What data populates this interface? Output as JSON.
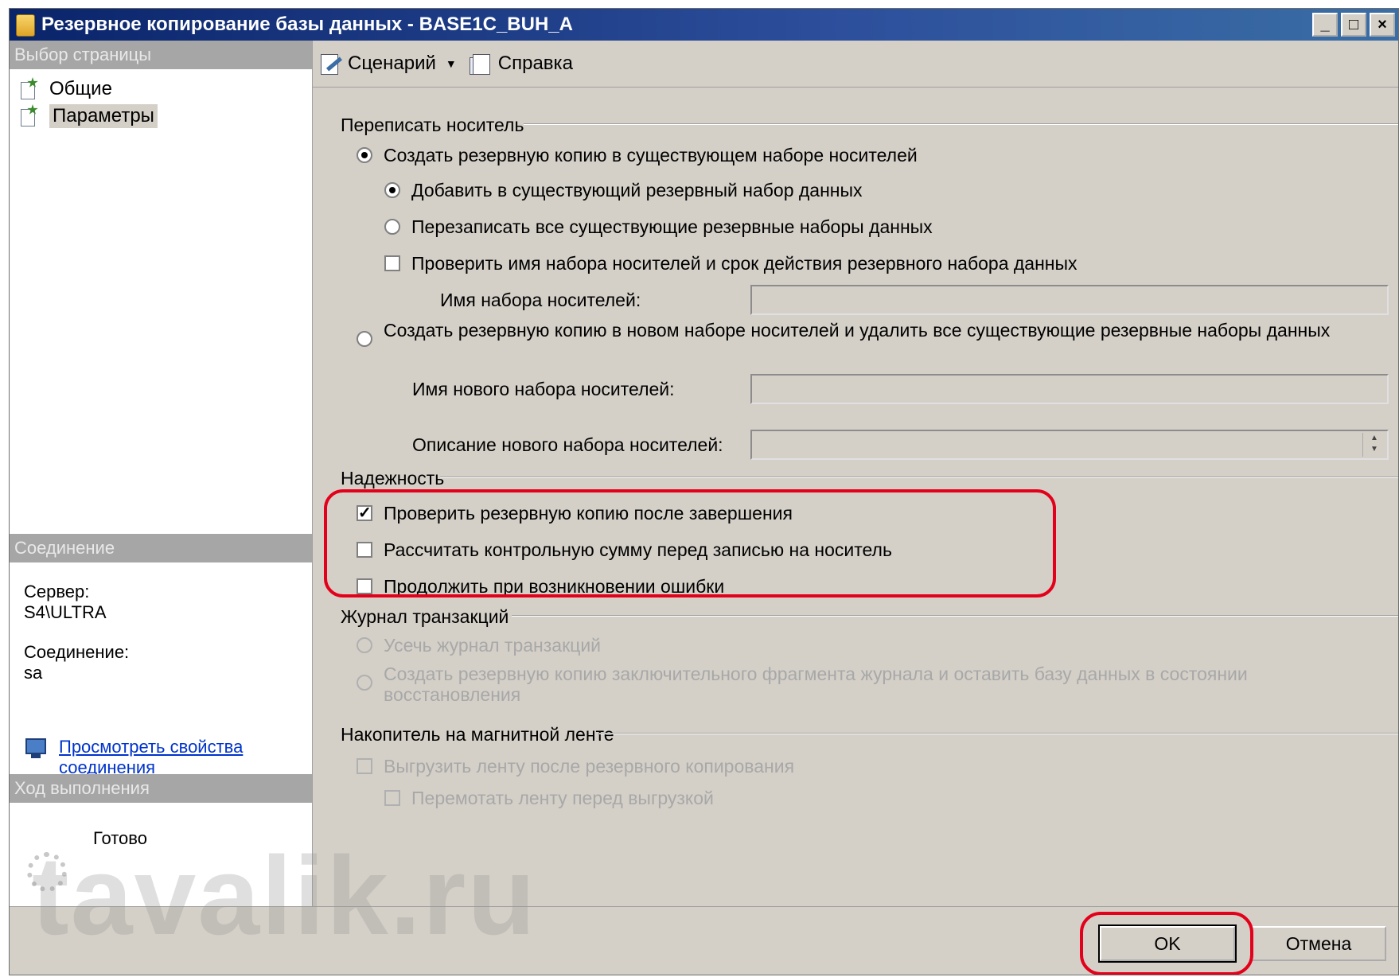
{
  "window": {
    "title": "Резервное копирование базы данных - BASE1C_BUH_A"
  },
  "left": {
    "select_page_header": "Выбор страницы",
    "pages": [
      {
        "label": "Общие"
      },
      {
        "label": "Параметры"
      }
    ],
    "connection_header": "Соединение",
    "server_label": "Сервер:",
    "server_value": "S4\\ULTRA",
    "connection_label": "Соединение:",
    "connection_value": "sa",
    "view_props_link": "Просмотреть свойства соединения",
    "progress_header": "Ход выполнения",
    "progress_status": "Готово"
  },
  "toolbar": {
    "script_label": "Сценарий",
    "help_label": "Справка"
  },
  "overwrite": {
    "header": "Переписать носитель",
    "backup_existing": "Создать резервную копию в существующем наборе носителей",
    "append": "Добавить в существующий резервный набор данных",
    "overwrite_all": "Перезаписать все существующие резервные наборы данных",
    "check_name": "Проверить имя набора носителей и срок действия резервного набора данных",
    "media_set_name_label": "Имя набора носителей:",
    "backup_new": "Создать резервную копию в новом наборе носителей и удалить все существующие резервные наборы данных",
    "new_media_name_label": "Имя нового набора носителей:",
    "new_media_desc_label": "Описание нового набора носителей:"
  },
  "reliability": {
    "header": "Надежность",
    "verify": "Проверить резервную копию после завершения",
    "checksum": "Рассчитать контрольную сумму перед записью на носитель",
    "continue_on_error": "Продолжить при возникновении ошибки"
  },
  "txlog": {
    "header": "Журнал транзакций",
    "truncate": "Усечь журнал транзакций",
    "tail_backup": "Создать резервную копию заключительного фрагмента журнала и оставить базу данных в состоянии восстановления"
  },
  "tape": {
    "header": "Накопитель на магнитной ленте",
    "unload": "Выгрузить ленту после резервного копирования",
    "rewind": "Перемотать ленту перед выгрузкой"
  },
  "buttons": {
    "ok": "OK",
    "cancel": "Отмена"
  },
  "watermark": "tavalik.ru",
  "colors": {
    "highlight": "#e3001b",
    "titlebar": "#0a246a",
    "link": "#0033cc"
  }
}
